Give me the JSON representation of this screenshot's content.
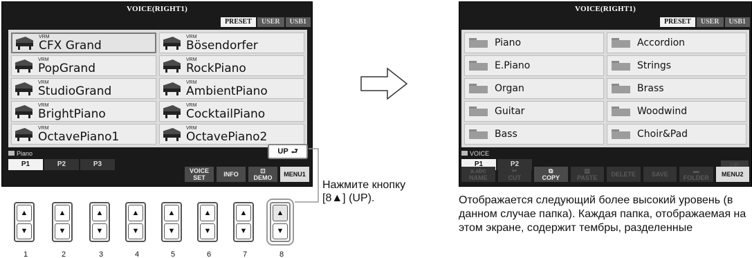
{
  "left_screen": {
    "title": "VOICE(RIGHT1)",
    "bank_tabs": [
      "PRESET",
      "USER",
      "USB1"
    ],
    "active_bank": "PRESET",
    "voices_left": [
      {
        "tag": "VRM",
        "name": "CFX Grand",
        "selected": true
      },
      {
        "tag": "VRM",
        "name": "PopGrand"
      },
      {
        "tag": "VRM",
        "name": "StudioGrand"
      },
      {
        "tag": "VRM",
        "name": "BrightPiano"
      },
      {
        "tag": "VRM",
        "name": "OctavePiano1"
      }
    ],
    "voices_right": [
      {
        "tag": "VRM",
        "name": "Bösendorfer"
      },
      {
        "tag": "VRM",
        "name": "RockPiano"
      },
      {
        "tag": "VRM",
        "name": "AmbientPiano"
      },
      {
        "tag": "VRM",
        "name": "CocktailPiano"
      },
      {
        "tag": "VRM",
        "name": "OctavePiano2"
      }
    ],
    "path": "Piano",
    "page_tabs": [
      "P1",
      "P2",
      "P3"
    ],
    "up_button": "UP",
    "func_buttons": [
      {
        "line1": "VOICE",
        "line2": "SET"
      },
      {
        "line1": "INFO",
        "line2": ""
      },
      {
        "line1": "",
        "line2": "DEMO"
      },
      {
        "line1": "MENU1",
        "line2": ""
      }
    ]
  },
  "right_screen": {
    "title": "VOICE(RIGHT1)",
    "bank_tabs": [
      "PRESET",
      "USER",
      "USB1"
    ],
    "active_bank": "PRESET",
    "folders_left": [
      "Piano",
      "E.Piano",
      "Organ",
      "Guitar",
      "Bass"
    ],
    "folders_right": [
      "Accordion",
      "Strings",
      "Brass",
      "Woodwind",
      "Choir&Pad"
    ],
    "path": "VOICE",
    "page_tabs": [
      "P1",
      "P2"
    ],
    "up_ghost": "UP",
    "func_buttons": [
      {
        "line1": "a.abc",
        "line2": "NAME",
        "state": "dim"
      },
      {
        "line1": "",
        "line2": "CUT",
        "state": "dim"
      },
      {
        "line1": "",
        "line2": "COPY",
        "state": "normal"
      },
      {
        "line1": "",
        "line2": "PASTE",
        "state": "dim"
      },
      {
        "line1": "",
        "line2": "DELETE",
        "state": "dim"
      },
      {
        "line1": "",
        "line2": "SAVE",
        "state": "dim"
      },
      {
        "line1": "",
        "line2": "FOLDER",
        "state": "dim"
      },
      {
        "line1": "",
        "line2": "MENU2",
        "state": "light"
      }
    ]
  },
  "hardware_buttons": {
    "numbers": [
      "1",
      "2",
      "3",
      "4",
      "5",
      "6",
      "7",
      "8"
    ],
    "up_symbol": "▲",
    "down_symbol": "▼",
    "highlighted": 8
  },
  "callout": {
    "line1": "Нажмите кнопку",
    "line2": "[8▲] (UP)."
  },
  "description": "Отображается следующий более высокий уровень (в данном случае папка). Каждая папка, отображаемая на этом экране, содержит тембры, разделенные"
}
